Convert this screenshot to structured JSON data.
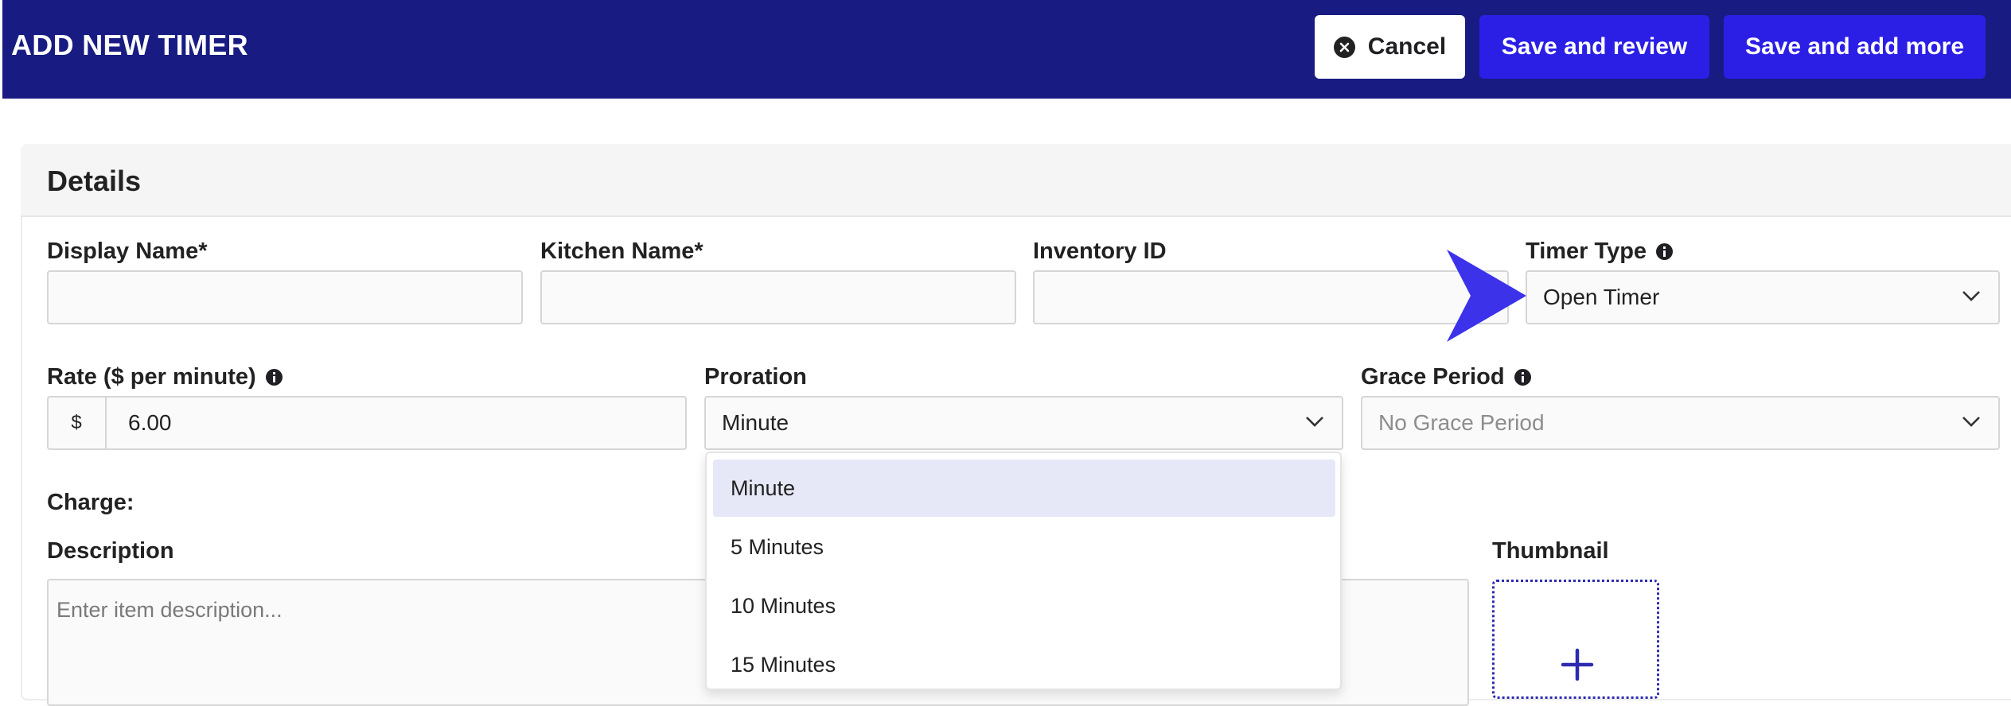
{
  "header": {
    "title": "ADD NEW TIMER",
    "cancel_label": "Cancel",
    "save_review_label": "Save and review",
    "save_more_label": "Save and add more",
    "bar_color": "#181c82",
    "accent_color": "#2b1fe6"
  },
  "details": {
    "title": "Details",
    "display_name": {
      "label": "Display Name*",
      "value": ""
    },
    "kitchen_name": {
      "label": "Kitchen Name*",
      "value": ""
    },
    "inventory_id": {
      "label": "Inventory ID",
      "value": ""
    },
    "timer_type": {
      "label": "Timer Type",
      "value": "Open Timer"
    },
    "rate": {
      "label": "Rate ($ per minute)",
      "prefix": "$",
      "value": "6.00"
    },
    "proration": {
      "label": "Proration",
      "value": "Minute",
      "options": [
        "Minute",
        "5 Minutes",
        "10 Minutes",
        "15 Minutes"
      ],
      "selected_index": 0
    },
    "grace_period": {
      "label": "Grace Period",
      "value": "No Grace Period"
    },
    "charge_label": "Charge:",
    "description": {
      "label": "Description",
      "placeholder": "Enter item description..."
    },
    "thumbnail_label": "Thumbnail"
  },
  "icons": {
    "cancel": "close-circle-icon",
    "info": "info-icon",
    "chevron": "chevron-down-icon",
    "add": "plus-icon",
    "pointer": "pointer-arrow-icon"
  }
}
